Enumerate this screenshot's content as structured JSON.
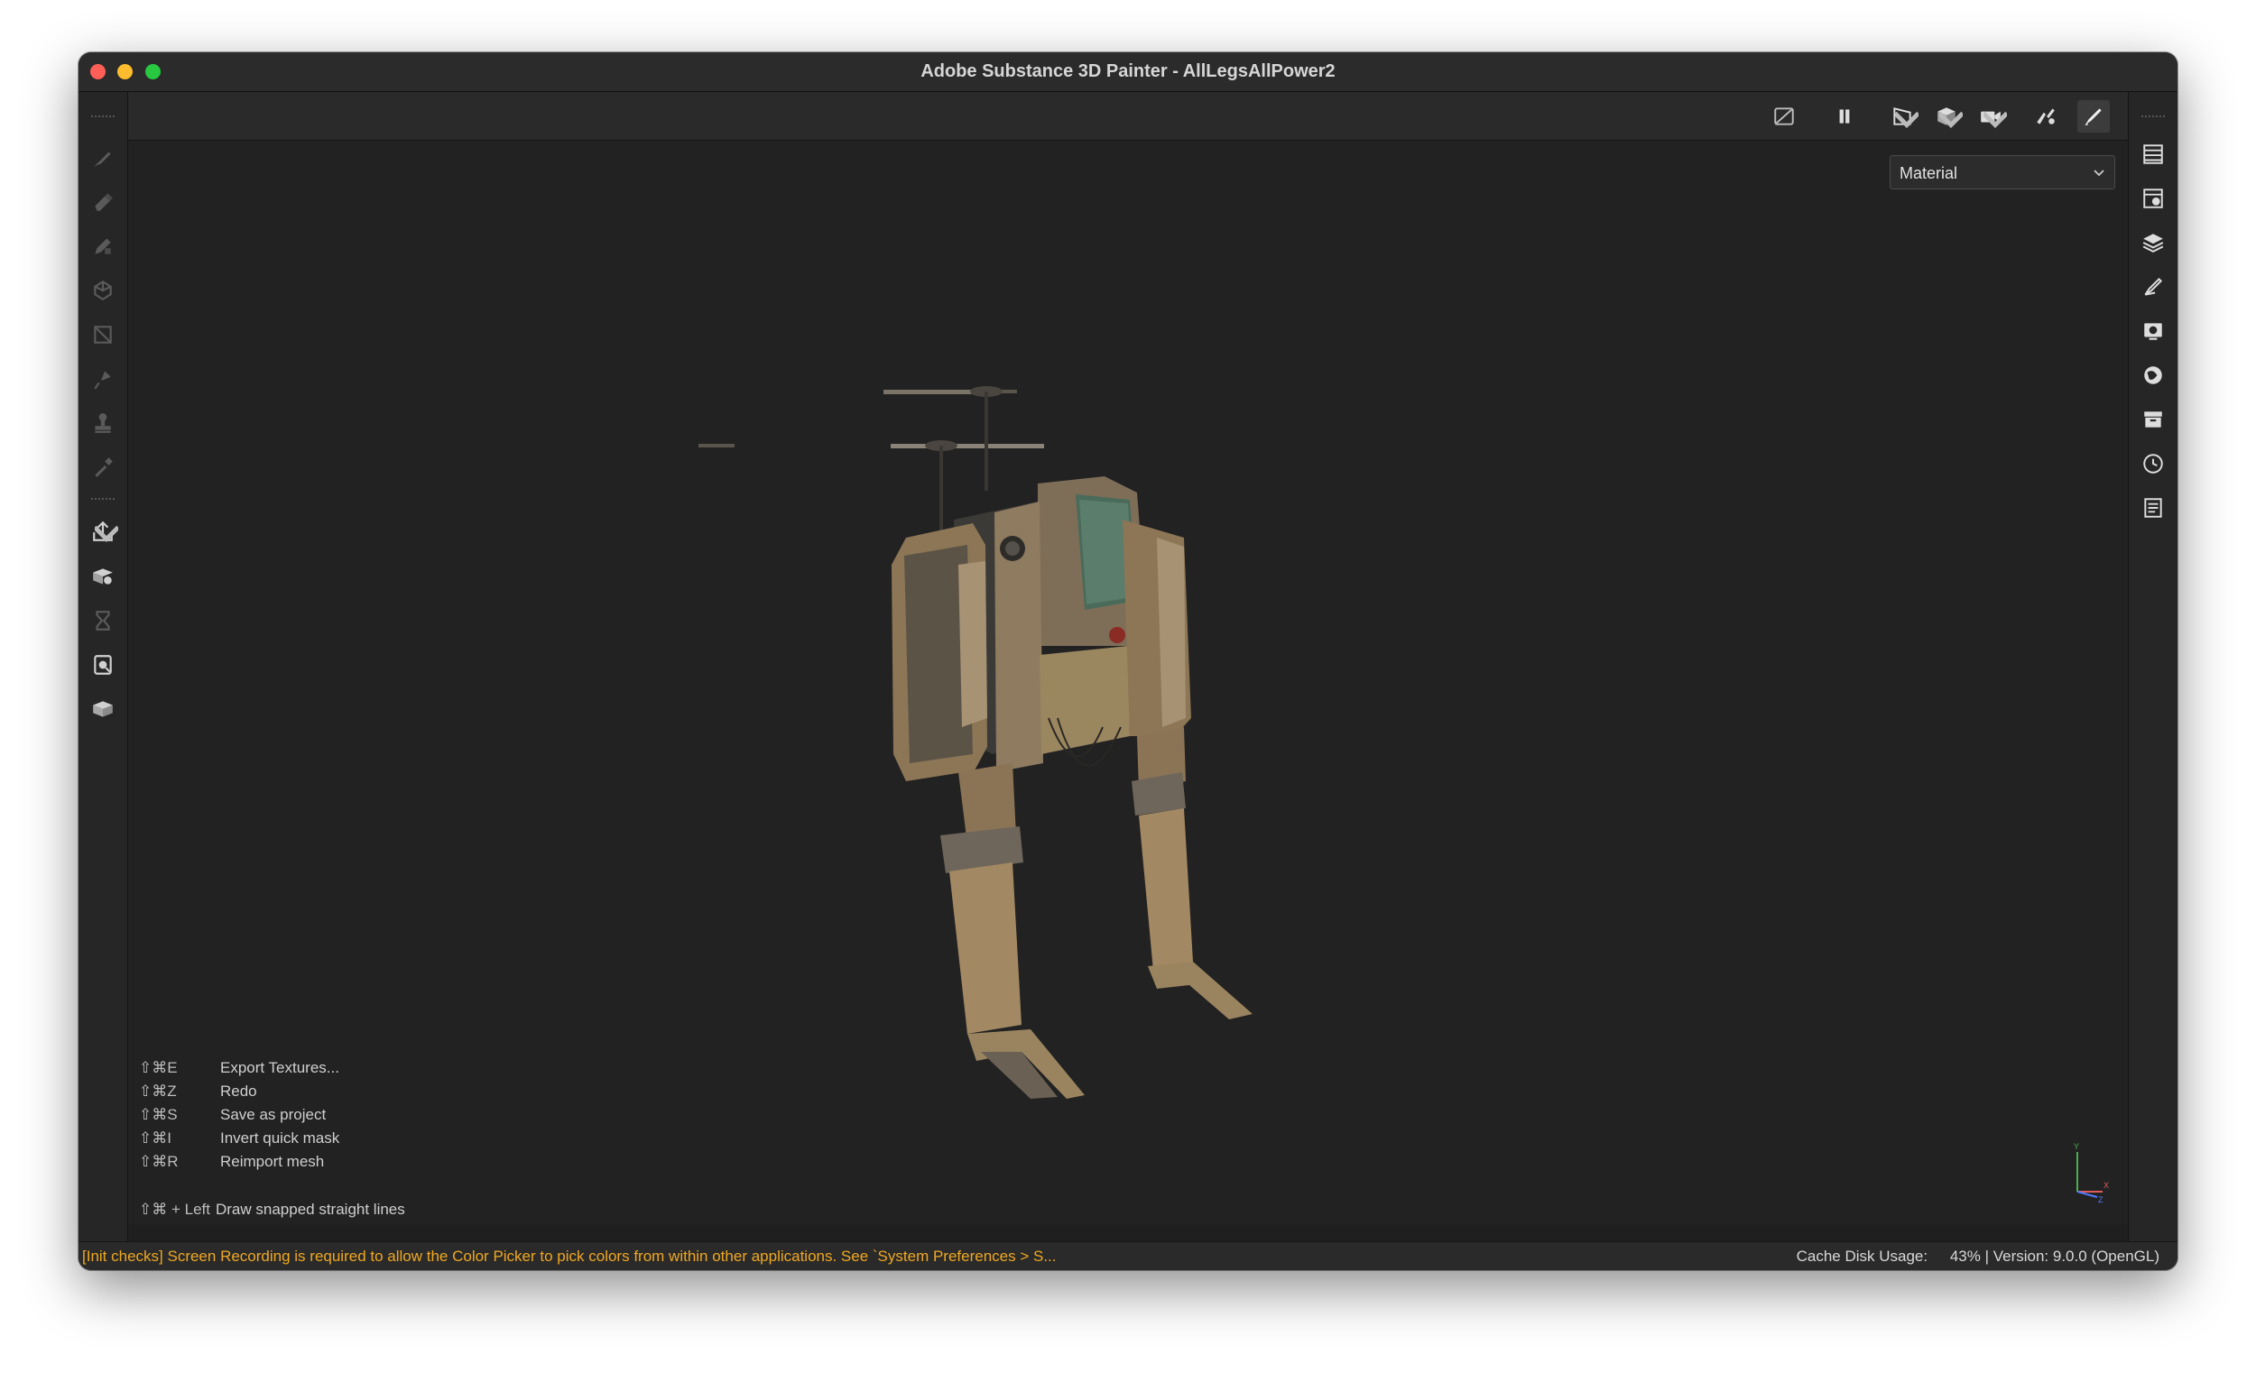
{
  "window": {
    "title": "Adobe Substance 3D Painter - AllLegsAllPower2"
  },
  "viewport": {
    "channel_select": "Material",
    "shortcuts": [
      {
        "key": "⇧⌘E",
        "action": "Export Textures..."
      },
      {
        "key": "⇧⌘Z",
        "action": "Redo"
      },
      {
        "key": "⇧⌘S",
        "action": "Save as project"
      },
      {
        "key": "⇧⌘I",
        "action": "Invert quick mask"
      },
      {
        "key": "⇧⌘R",
        "action": "Reimport mesh"
      }
    ],
    "extra_shortcut": {
      "key": "⇧⌘ + Left",
      "action": "Draw snapped straight lines"
    },
    "axis": {
      "y": "Y",
      "x": "X",
      "z": "Z"
    }
  },
  "left_toolbar": [
    "paint-brush-icon",
    "eraser-icon",
    "projection-icon",
    "geometry-mask-icon",
    "polygon-fill-icon",
    "smudge-icon",
    "clone-stamp-icon",
    "color-picker-icon",
    "export-icon",
    "bake-icon",
    "iray-icon",
    "display-settings-icon",
    "mesh-icon"
  ],
  "right_toolbar": [
    "texture-set-list-icon",
    "texture-set-settings-icon",
    "layers-icon",
    "properties-icon",
    "display-settings-icon",
    "shader-settings-icon",
    "assets-icon",
    "history-icon",
    "log-icon"
  ],
  "top_toolbar": [
    "hide-ui-icon",
    "pause-icon",
    "mirror-plane-icon",
    "cube-view-icon",
    "camera-icon",
    "symmetry-icon",
    "paint-mode-icon",
    "screenshot-icon"
  ],
  "statusbar": {
    "message": "[Init checks] Screen Recording is required to allow the Color Picker to pick colors from within other applications. See `System Preferences > S...",
    "cache_label": "Cache Disk Usage:",
    "cache_value": "43% | Version: 9.0.0 (OpenGL)"
  },
  "colors": {
    "accent": "#f0a820",
    "viewport_bg": "#222222",
    "toolbar_bg": "#262626"
  }
}
